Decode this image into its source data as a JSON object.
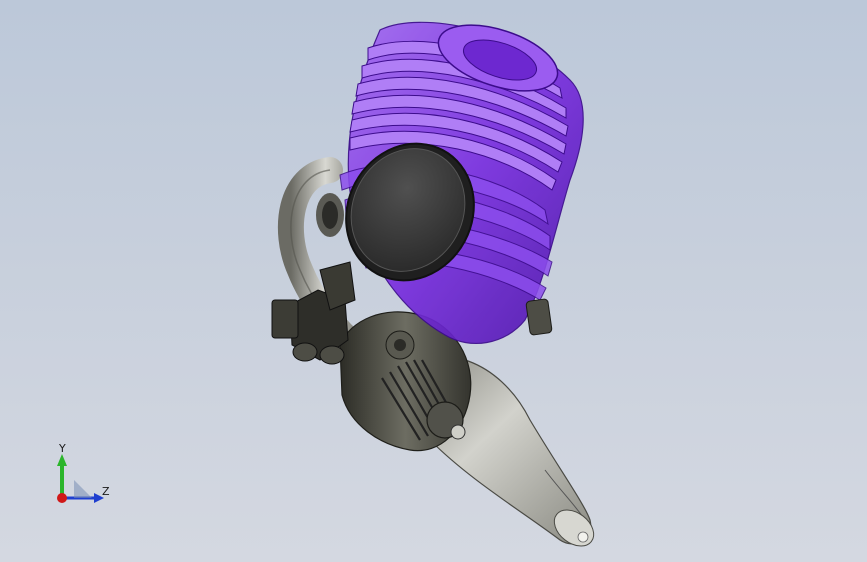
{
  "viewport": {
    "background_top": "#bcc8d9",
    "background_bottom": "#d4d8e1"
  },
  "model": {
    "name": "engine-assembly",
    "colors": {
      "cylinder_head": "#7a2fe0",
      "cylinder_head_light": "#a46bf2",
      "cylinder_head_dark": "#4c14a8",
      "crankcase": "#3d3d35",
      "crankcase_light": "#6d6d62",
      "muffler": "#9a9a92",
      "muffler_light": "#d2d2cc",
      "backplate": "#3a3a3a",
      "backplate_rim": "#1f1f1f"
    }
  },
  "triad": {
    "y_label": "Y",
    "z_label": "Z",
    "y_color": "#2bb52b",
    "z_color": "#1f3fcf",
    "x_color": "#d01818"
  }
}
